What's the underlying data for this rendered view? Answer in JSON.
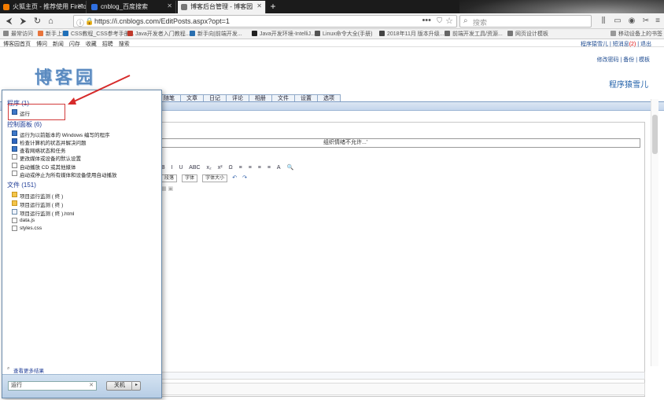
{
  "browser": {
    "tabs": [
      {
        "title": "火狐主页 - 推荐使用 Firefox 浏览器",
        "icon_color": "#f57c00",
        "active": false
      },
      {
        "title": "cnblog_百度搜索",
        "icon_color": "#2f6fe0",
        "active": false
      },
      {
        "title": "博客后台管理 - 博客园",
        "icon_color": "#777777",
        "active": true
      }
    ],
    "new_tab": "+",
    "url": "https://i.cnblogs.com/EditPosts.aspx?opt=1",
    "search_placeholder": "搜索",
    "more_button": "•••",
    "bookmarks": [
      {
        "label": "最常访问",
        "color": "#888888"
      },
      {
        "label": "新手上路",
        "color": "#e8743b"
      },
      {
        "label": "CSS教程_CSS参考手册...",
        "color": "#1f6fb8"
      },
      {
        "label": "Java开发者入门教程...",
        "color": "#c0392b"
      },
      {
        "label": "新手向|前端开发...",
        "color": "#2a6fb0"
      },
      {
        "label": "Java开发环境-IntelliJ...",
        "color": "#222222"
      },
      {
        "label": "Linux命令大全(手册)",
        "color": "#555555"
      },
      {
        "label": "2018年11月 版本升级...",
        "color": "#444444"
      },
      {
        "label": "前端开发工具/资源...",
        "color": "#666666"
      },
      {
        "label": "网页设计模板",
        "color": "#777777"
      }
    ],
    "bookmark_more": "移动设备上的书签"
  },
  "site_nav": {
    "links": [
      "博客园首页",
      "博问",
      "新闻",
      "闪存",
      "收藏",
      "招聘",
      "搜索"
    ],
    "user": "程序猿雪儿",
    "messages": "短消息",
    "message_count": "(2)",
    "logout": "退出"
  },
  "header": {
    "logo": "博客园",
    "links": "修改密码 | 备份 | 模板",
    "blog_name": "程序猿雪儿"
  },
  "menu_tabs": [
    "随笔",
    "文章",
    "日记",
    "评论",
    "相册",
    "文件",
    "设置",
    "选项"
  ],
  "editor": {
    "title_hint": "组织情绪不允许...'",
    "toolbar_row1": [
      "B",
      "I",
      "U",
      "ABC",
      "x₂",
      "x²",
      "Ω",
      "≡",
      "≡",
      "≡",
      "≡",
      "A",
      "🔍"
    ],
    "format_select": "段落",
    "font_select": "字体",
    "size_select": "字体大小"
  },
  "start_menu": {
    "groups": [
      {
        "title": "程序 (1)",
        "items": [
          {
            "label": "运行",
            "icon": "blue"
          }
        ]
      },
      {
        "title": "控制面板 (6)",
        "items": [
          {
            "label": "运行为以前版本的 Windows 编写的程序",
            "icon": "blue"
          },
          {
            "label": "检查计算机的状态并解决问题",
            "icon": "flag"
          },
          {
            "label": "查看网络状态和任务",
            "icon": "blue"
          },
          {
            "label": "更改媒体或设备的默认设置",
            "icon": "doc"
          },
          {
            "label": "自动播放 CD 或其他媒体",
            "icon": "doc"
          },
          {
            "label": "启动或停止为所有媒体和设备使用自动播放",
            "icon": "doc"
          }
        ]
      },
      {
        "title": "文件 (151)",
        "items": [
          {
            "label": "项目运行监测 ( 终 )",
            "icon": "folder"
          },
          {
            "label": "项目运行监测 ( 终 )",
            "icon": "folder"
          },
          {
            "label": "项目运行监测 ( 终 ).html",
            "icon": "html"
          },
          {
            "label": "data.js",
            "icon": "doc"
          },
          {
            "label": "styles.css",
            "icon": "doc"
          }
        ]
      }
    ],
    "see_more": "查看更多结果",
    "search_value": "运行",
    "shutdown": "关机"
  },
  "colors": {
    "accent": "#1e3c96",
    "annotation": "#d23b3b"
  }
}
